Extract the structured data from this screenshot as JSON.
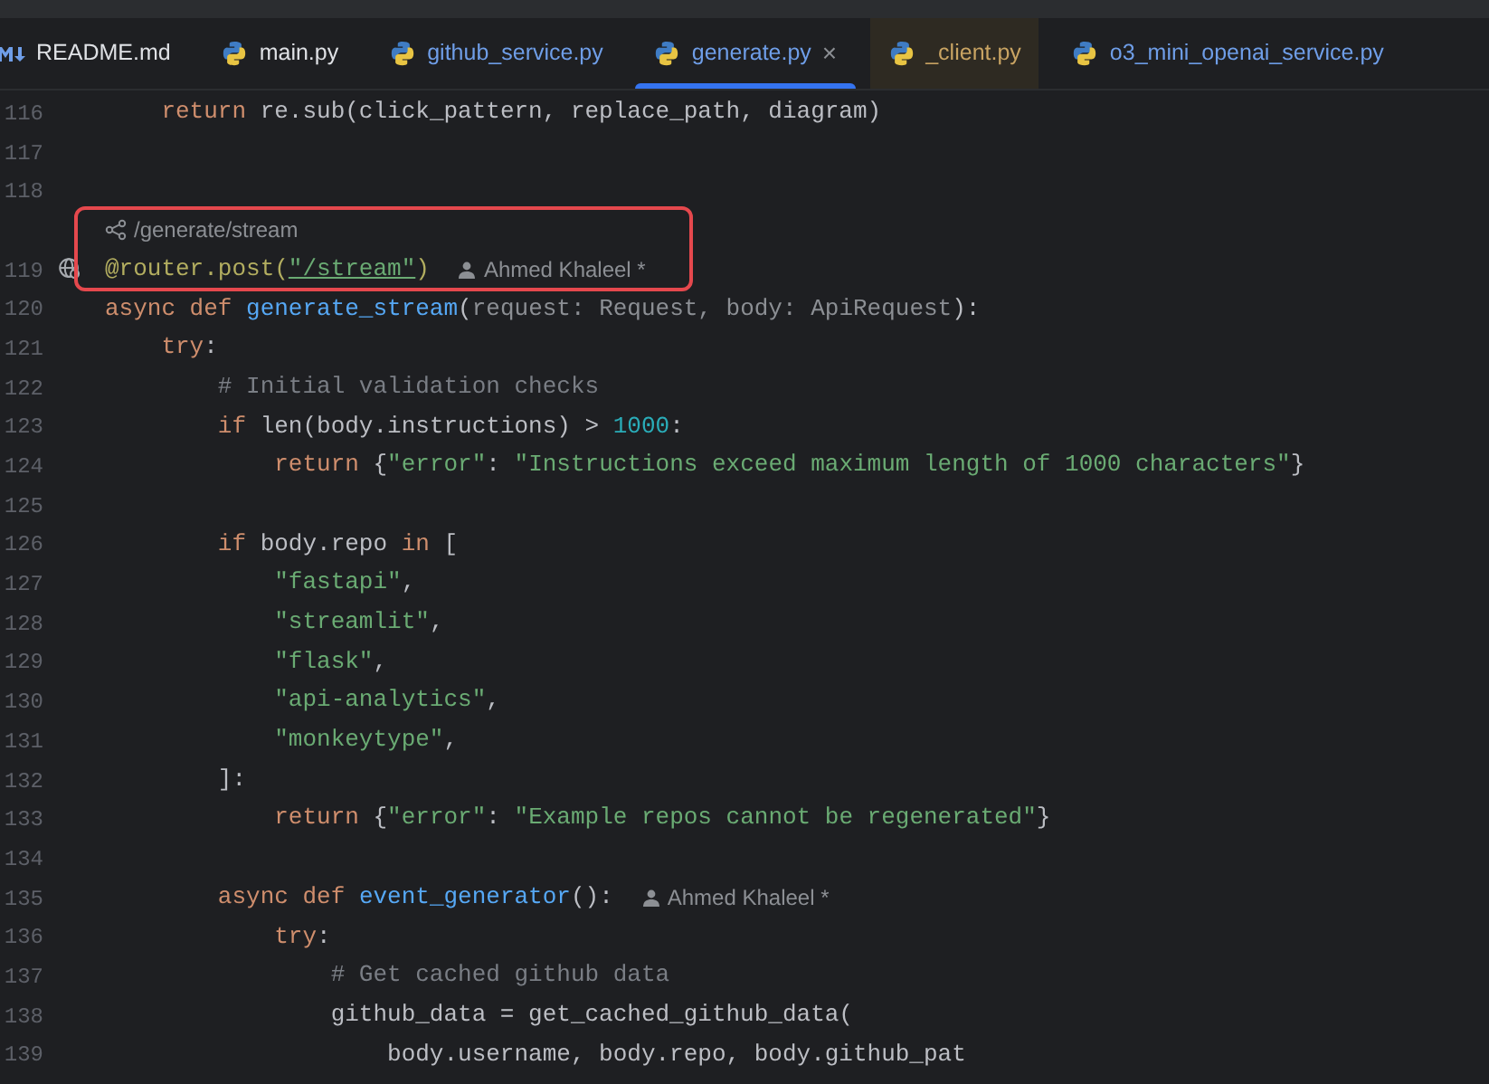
{
  "tabs": [
    {
      "label": "README.md",
      "kind": "markdown",
      "selected": false,
      "highlighted": false,
      "color": "#dfe1e5"
    },
    {
      "label": "main.py",
      "kind": "python",
      "selected": false,
      "highlighted": false,
      "color": "#dfe1e5"
    },
    {
      "label": "github_service.py",
      "kind": "python",
      "selected": false,
      "highlighted": false,
      "color": "#6f9ee8"
    },
    {
      "label": "generate.py",
      "kind": "python",
      "selected": true,
      "highlighted": false,
      "color": "#6f9ee8",
      "close": "×"
    },
    {
      "label": "_client.py",
      "kind": "python",
      "selected": false,
      "highlighted": true,
      "color": "#c9a463"
    },
    {
      "label": "o3_mini_openai_service.py",
      "kind": "python",
      "selected": false,
      "highlighted": false,
      "color": "#6f9ee8"
    }
  ],
  "lines": [
    {
      "kind": "code",
      "number": "116",
      "tokens": [
        {
          "kind": "keyword",
          "text": "    return "
        },
        {
          "kind": "plain",
          "text": "re.sub(click_pattern, replace_path, diagram)"
        }
      ]
    },
    {
      "kind": "code",
      "number": "117"
    },
    {
      "kind": "code",
      "number": "118"
    },
    {
      "kind": "endpoint",
      "text": "/generate/stream",
      "boxed": true
    },
    {
      "kind": "code",
      "number": "119",
      "boxed": true,
      "marker": true,
      "tokens": [
        {
          "kind": "decorator",
          "text": "@router.post("
        },
        {
          "kind": "link",
          "text": "\"/stream\""
        },
        {
          "kind": "decorator",
          "text": ")"
        }
      ],
      "author": "Ahmed Khaleel *"
    },
    {
      "kind": "code",
      "number": "120",
      "tokens": [
        {
          "kind": "keyword",
          "text": "async def "
        },
        {
          "kind": "function",
          "text": "generate_stream"
        },
        {
          "kind": "plain",
          "text": "("
        },
        {
          "kind": "unused",
          "text": "request: Request, body: ApiRequest"
        },
        {
          "kind": "plain",
          "text": "):"
        }
      ]
    },
    {
      "kind": "code",
      "number": "121",
      "tokens": [
        {
          "kind": "keyword",
          "text": "    try"
        },
        {
          "kind": "plain",
          "text": ":"
        }
      ]
    },
    {
      "kind": "code",
      "number": "122",
      "tokens": [
        {
          "kind": "comment",
          "text": "        # Initial validation checks"
        }
      ]
    },
    {
      "kind": "code",
      "number": "123",
      "tokens": [
        {
          "kind": "keyword",
          "text": "        if "
        },
        {
          "kind": "plain",
          "text": "len(body.instructions) > "
        },
        {
          "kind": "number",
          "text": "1000"
        },
        {
          "kind": "plain",
          "text": ":"
        }
      ]
    },
    {
      "kind": "code",
      "number": "124",
      "tokens": [
        {
          "kind": "keyword",
          "text": "            return "
        },
        {
          "kind": "plain",
          "text": "{"
        },
        {
          "kind": "string",
          "text": "\"error\""
        },
        {
          "kind": "plain",
          "text": ": "
        },
        {
          "kind": "string",
          "text": "\"Instructions exceed maximum length of 1000 characters\""
        },
        {
          "kind": "plain",
          "text": "}"
        }
      ]
    },
    {
      "kind": "code",
      "number": "125"
    },
    {
      "kind": "code",
      "number": "126",
      "tokens": [
        {
          "kind": "keyword",
          "text": "        if "
        },
        {
          "kind": "plain",
          "text": "body.repo "
        },
        {
          "kind": "keyword",
          "text": "in "
        },
        {
          "kind": "plain",
          "text": "["
        }
      ]
    },
    {
      "kind": "code",
      "number": "127",
      "tokens": [
        {
          "kind": "string",
          "text": "            \"fastapi\""
        },
        {
          "kind": "plain",
          "text": ","
        }
      ]
    },
    {
      "kind": "code",
      "number": "128",
      "tokens": [
        {
          "kind": "string",
          "text": "            \"streamlit\""
        },
        {
          "kind": "plain",
          "text": ","
        }
      ]
    },
    {
      "kind": "code",
      "number": "129",
      "tokens": [
        {
          "kind": "string",
          "text": "            \"flask\""
        },
        {
          "kind": "plain",
          "text": ","
        }
      ]
    },
    {
      "kind": "code",
      "number": "130",
      "tokens": [
        {
          "kind": "string",
          "text": "            \"api-analytics\""
        },
        {
          "kind": "plain",
          "text": ","
        }
      ]
    },
    {
      "kind": "code",
      "number": "131",
      "tokens": [
        {
          "kind": "string",
          "text": "            \"monkeytype\""
        },
        {
          "kind": "plain",
          "text": ","
        }
      ]
    },
    {
      "kind": "code",
      "number": "132",
      "tokens": [
        {
          "kind": "plain",
          "text": "        ]:"
        }
      ]
    },
    {
      "kind": "code",
      "number": "133",
      "tokens": [
        {
          "kind": "keyword",
          "text": "            return "
        },
        {
          "kind": "plain",
          "text": "{"
        },
        {
          "kind": "string",
          "text": "\"error\""
        },
        {
          "kind": "plain",
          "text": ": "
        },
        {
          "kind": "string",
          "text": "\"Example repos cannot be regenerated\""
        },
        {
          "kind": "plain",
          "text": "}"
        }
      ]
    },
    {
      "kind": "code",
      "number": "134"
    },
    {
      "kind": "code",
      "number": "135",
      "tokens": [
        {
          "kind": "keyword",
          "text": "        async def "
        },
        {
          "kind": "function",
          "text": "event_generator"
        },
        {
          "kind": "plain",
          "text": "():"
        }
      ],
      "author": "Ahmed Khaleel *"
    },
    {
      "kind": "code",
      "number": "136",
      "tokens": [
        {
          "kind": "keyword",
          "text": "            try"
        },
        {
          "kind": "plain",
          "text": ":"
        }
      ]
    },
    {
      "kind": "code",
      "number": "137",
      "tokens": [
        {
          "kind": "comment",
          "text": "                # Get cached github data"
        }
      ]
    },
    {
      "kind": "code",
      "number": "138",
      "tokens": [
        {
          "kind": "plain",
          "text": "                github_data = get_cached_github_data("
        }
      ]
    },
    {
      "kind": "code",
      "number": "139",
      "tokens": [
        {
          "kind": "plain",
          "text": "                    body.username, body.repo, body.github_pat"
        }
      ]
    }
  ]
}
